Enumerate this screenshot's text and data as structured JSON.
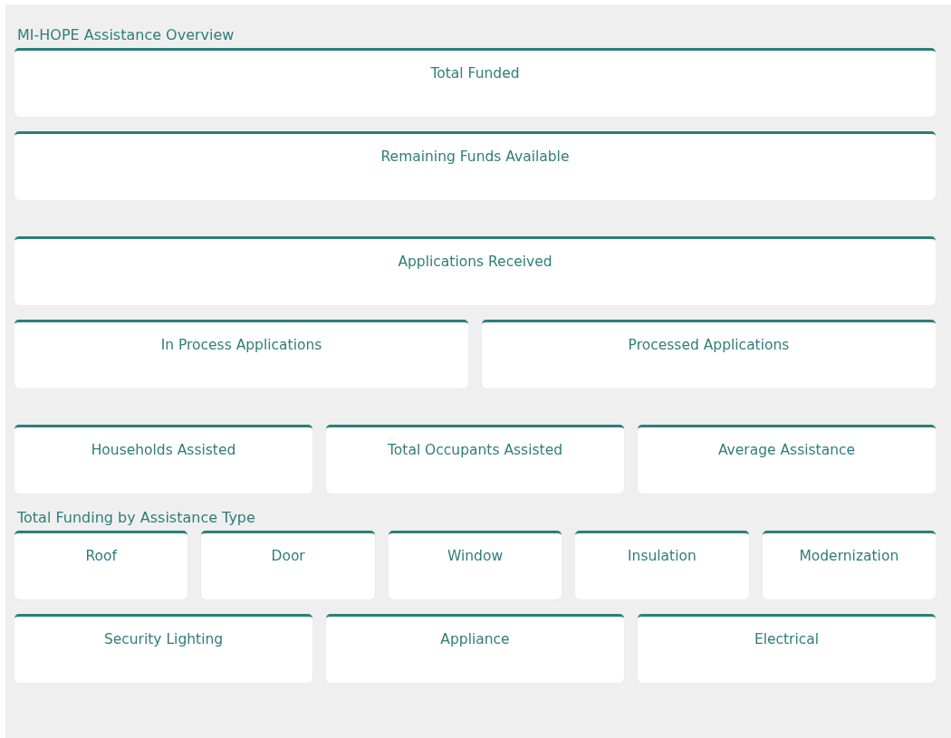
{
  "sections": [
    {
      "title": "MI-HOPE Assistance Overview",
      "groups": [
        [
          [
            {
              "label": "Total Funded"
            }
          ],
          [
            {
              "label": "Remaining Funds Available"
            }
          ]
        ],
        [
          [
            {
              "label": "Applications Received"
            }
          ],
          [
            {
              "label": "In Process Applications"
            },
            {
              "label": "Processed Applications"
            }
          ]
        ],
        [
          [
            {
              "label": "Households Assisted"
            },
            {
              "label": "Total Occupants Assisted"
            },
            {
              "label": "Average Assistance"
            }
          ]
        ]
      ]
    },
    {
      "title": "Total Funding by Assistance Type",
      "groups": [
        [
          [
            {
              "label": "Roof"
            },
            {
              "label": "Door"
            },
            {
              "label": "Window"
            },
            {
              "label": "Insulation"
            },
            {
              "label": "Modernization"
            }
          ],
          [
            {
              "label": "Security Lighting"
            },
            {
              "label": "Appliance"
            },
            {
              "label": "Electrical"
            }
          ]
        ]
      ]
    }
  ]
}
